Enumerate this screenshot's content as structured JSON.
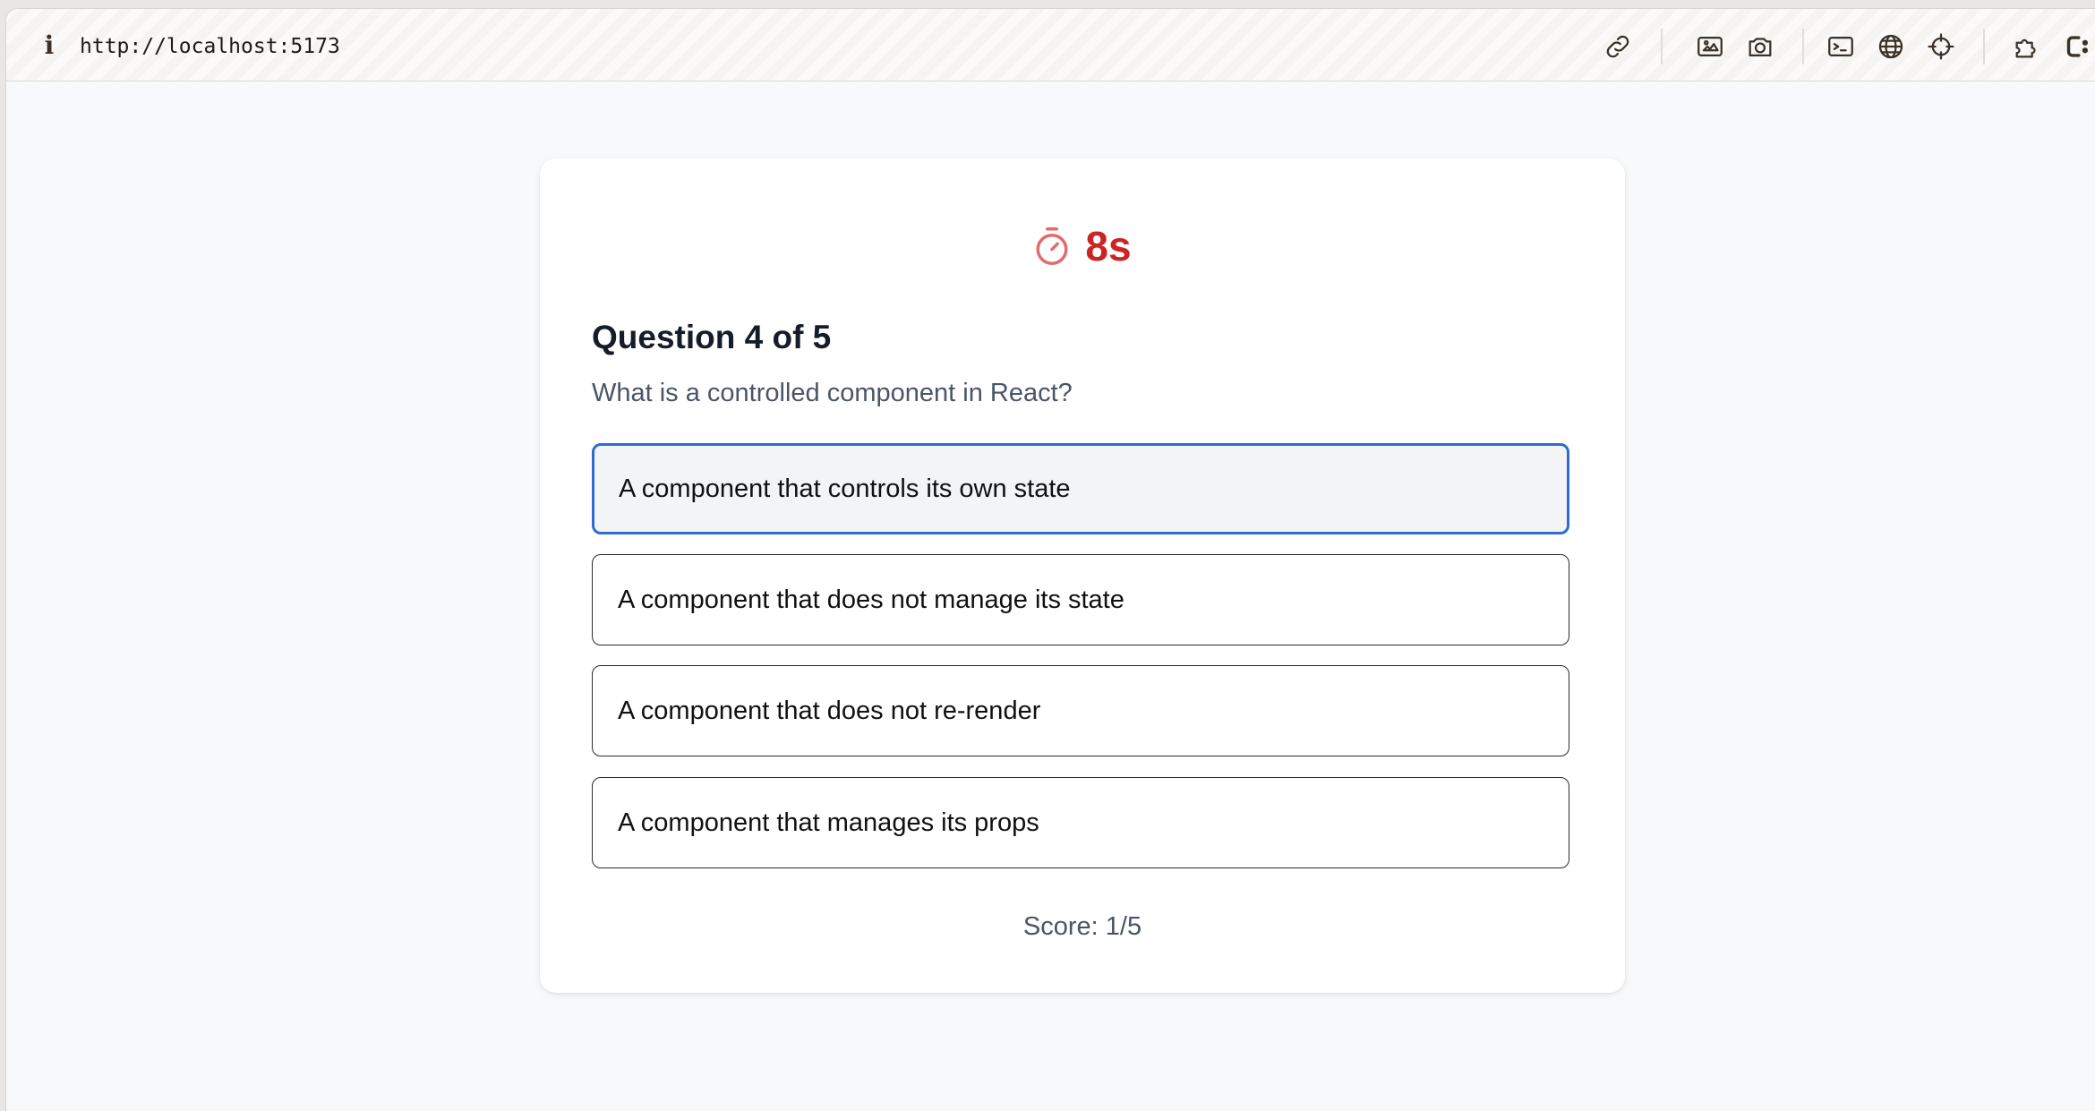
{
  "browser": {
    "url": "http://localhost:5173",
    "info_icon": "i",
    "toolbar_icons": [
      "link-icon",
      "gallery-icon",
      "camera-icon",
      "terminal-icon",
      "globe-icon",
      "crosshair-icon",
      "extensions-icon",
      "css-icon"
    ]
  },
  "quiz": {
    "timer": "8s",
    "title": "Question 4 of 5",
    "question": "What is a controlled component in React?",
    "options": [
      "A component that controls its own state",
      "A component that does not manage its state",
      "A component that does not re-render",
      "A component that manages its props"
    ],
    "selected_option": 0,
    "score": "Score: 1/5"
  },
  "colors": {
    "timer": "#cc2424",
    "selected_border": "#2f6bd1",
    "selected_bg": "#f3f4f6",
    "page_bg": "#f8f9fb"
  }
}
